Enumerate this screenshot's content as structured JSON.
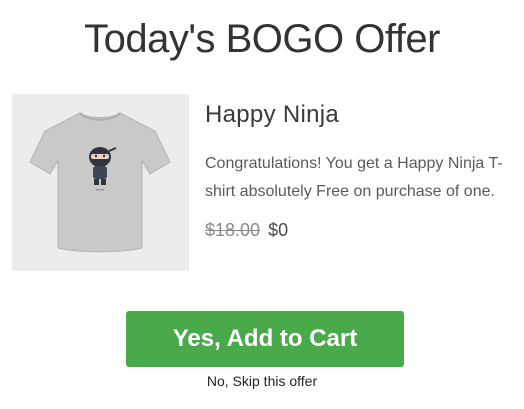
{
  "offer": {
    "title": "Today's BOGO Offer",
    "product": {
      "image_icon": "tshirt-ninja-image",
      "name": "Happy Ninja",
      "description": "Congratulations! You get a Happy Ninja T-shirt absolutely Free on purchase of one.",
      "original_price": "$18.00",
      "offer_price": "$0"
    },
    "accept_label": "Yes, Add to Cart",
    "skip_label": "No, Skip this offer"
  },
  "colors": {
    "accept_button": "#4aa94a",
    "image_background": "#ececec",
    "tshirt": "#c9c9c9"
  }
}
